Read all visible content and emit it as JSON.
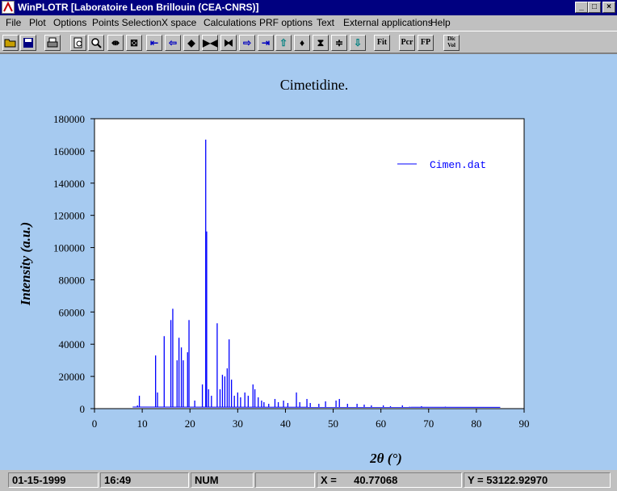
{
  "window": {
    "title": "WinPLOTR [Laboratoire Leon Brillouin (CEA-CNRS)]",
    "controls": [
      "_",
      "□",
      "×"
    ]
  },
  "menu": [
    "File",
    "Plot",
    "Options",
    "Points Selection",
    "X space",
    "Calculations",
    "PRF options",
    "Text",
    "External applications",
    "Help"
  ],
  "toolbar": {
    "buttons": [
      "open-icon",
      "save-icon",
      "print-icon",
      "zoom-page-icon",
      "zoom-icon",
      "expand-x-icon",
      "fit-icon",
      "left-limit-icon",
      "left-arrow-icon",
      "expand-lr-icon",
      "shrink-left-icon",
      "shrink-lr-icon",
      "right-arrow-icon",
      "right-limit-icon",
      "up-arrow-icon",
      "expand-ud-icon",
      "shrink-ud-icon",
      "expand-up-icon",
      "down-arrow-icon"
    ],
    "fit_label": "Fit",
    "pcr_label": "Pcr",
    "fp_label": "FP",
    "dic_label": "Dic Vol"
  },
  "chart_data": {
    "type": "line",
    "title": "Cimetidine.",
    "xlabel": "2θ (°)",
    "ylabel": "Intensity (a.u.)",
    "xlim": [
      0,
      90
    ],
    "ylim": [
      0,
      180000
    ],
    "xticks": [
      "0",
      "10",
      "20",
      "30",
      "40",
      "50",
      "60",
      "70",
      "80",
      "90"
    ],
    "yticks": [
      "0",
      "20000",
      "40000",
      "60000",
      "80000",
      "100000",
      "120000",
      "140000",
      "160000",
      "180000"
    ],
    "legend": "top-right",
    "series": [
      {
        "name": "Cimen.dat",
        "color": "#0000ff",
        "peaks": [
          [
            9.0,
            2000
          ],
          [
            9.4,
            8000
          ],
          [
            12.8,
            33000
          ],
          [
            13.2,
            10000
          ],
          [
            14.6,
            45000
          ],
          [
            16.0,
            55000
          ],
          [
            16.4,
            62000
          ],
          [
            17.3,
            30000
          ],
          [
            17.7,
            44000
          ],
          [
            18.2,
            38000
          ],
          [
            18.6,
            30000
          ],
          [
            19.5,
            35000
          ],
          [
            19.8,
            55000
          ],
          [
            21.0,
            5000
          ],
          [
            22.6,
            15000
          ],
          [
            23.3,
            167000
          ],
          [
            23.5,
            110000
          ],
          [
            23.9,
            12000
          ],
          [
            24.5,
            8000
          ],
          [
            25.7,
            53000
          ],
          [
            26.3,
            12000
          ],
          [
            26.8,
            21000
          ],
          [
            27.3,
            20000
          ],
          [
            27.8,
            25000
          ],
          [
            28.2,
            43000
          ],
          [
            28.7,
            18000
          ],
          [
            29.3,
            8000
          ],
          [
            30.0,
            10000
          ],
          [
            30.6,
            7000
          ],
          [
            31.5,
            10000
          ],
          [
            32.2,
            8000
          ],
          [
            33.2,
            15000
          ],
          [
            33.6,
            12000
          ],
          [
            34.3,
            7000
          ],
          [
            35.0,
            5000
          ],
          [
            35.5,
            4000
          ],
          [
            36.5,
            3000
          ],
          [
            37.8,
            6000
          ],
          [
            38.5,
            4000
          ],
          [
            39.6,
            5000
          ],
          [
            40.5,
            3500
          ],
          [
            42.3,
            10000
          ],
          [
            43.0,
            4000
          ],
          [
            44.5,
            6000
          ],
          [
            45.2,
            3500
          ],
          [
            47.0,
            3000
          ],
          [
            48.4,
            4500
          ],
          [
            50.6,
            5000
          ],
          [
            51.3,
            6000
          ],
          [
            53.0,
            3000
          ],
          [
            55.0,
            3000
          ],
          [
            56.5,
            2500
          ],
          [
            58.0,
            2000
          ],
          [
            60.5,
            2000
          ],
          [
            62.0,
            1500
          ],
          [
            64.5,
            2000
          ],
          [
            66.0,
            1200
          ],
          [
            68.5,
            1500
          ],
          [
            71.0,
            1000
          ],
          [
            73.5,
            1200
          ],
          [
            76.0,
            1000
          ],
          [
            78.5,
            900
          ],
          [
            81.0,
            900
          ],
          [
            83.5,
            800
          ]
        ],
        "x_start": 8.0,
        "x_end": 85.0
      }
    ]
  },
  "status": {
    "date": "01-15-1999",
    "time": "16:49",
    "mode": "NUM",
    "x_label": "X =",
    "x_value": "40.77068",
    "y_label": "Y =",
    "y_value": "53122.92970"
  }
}
